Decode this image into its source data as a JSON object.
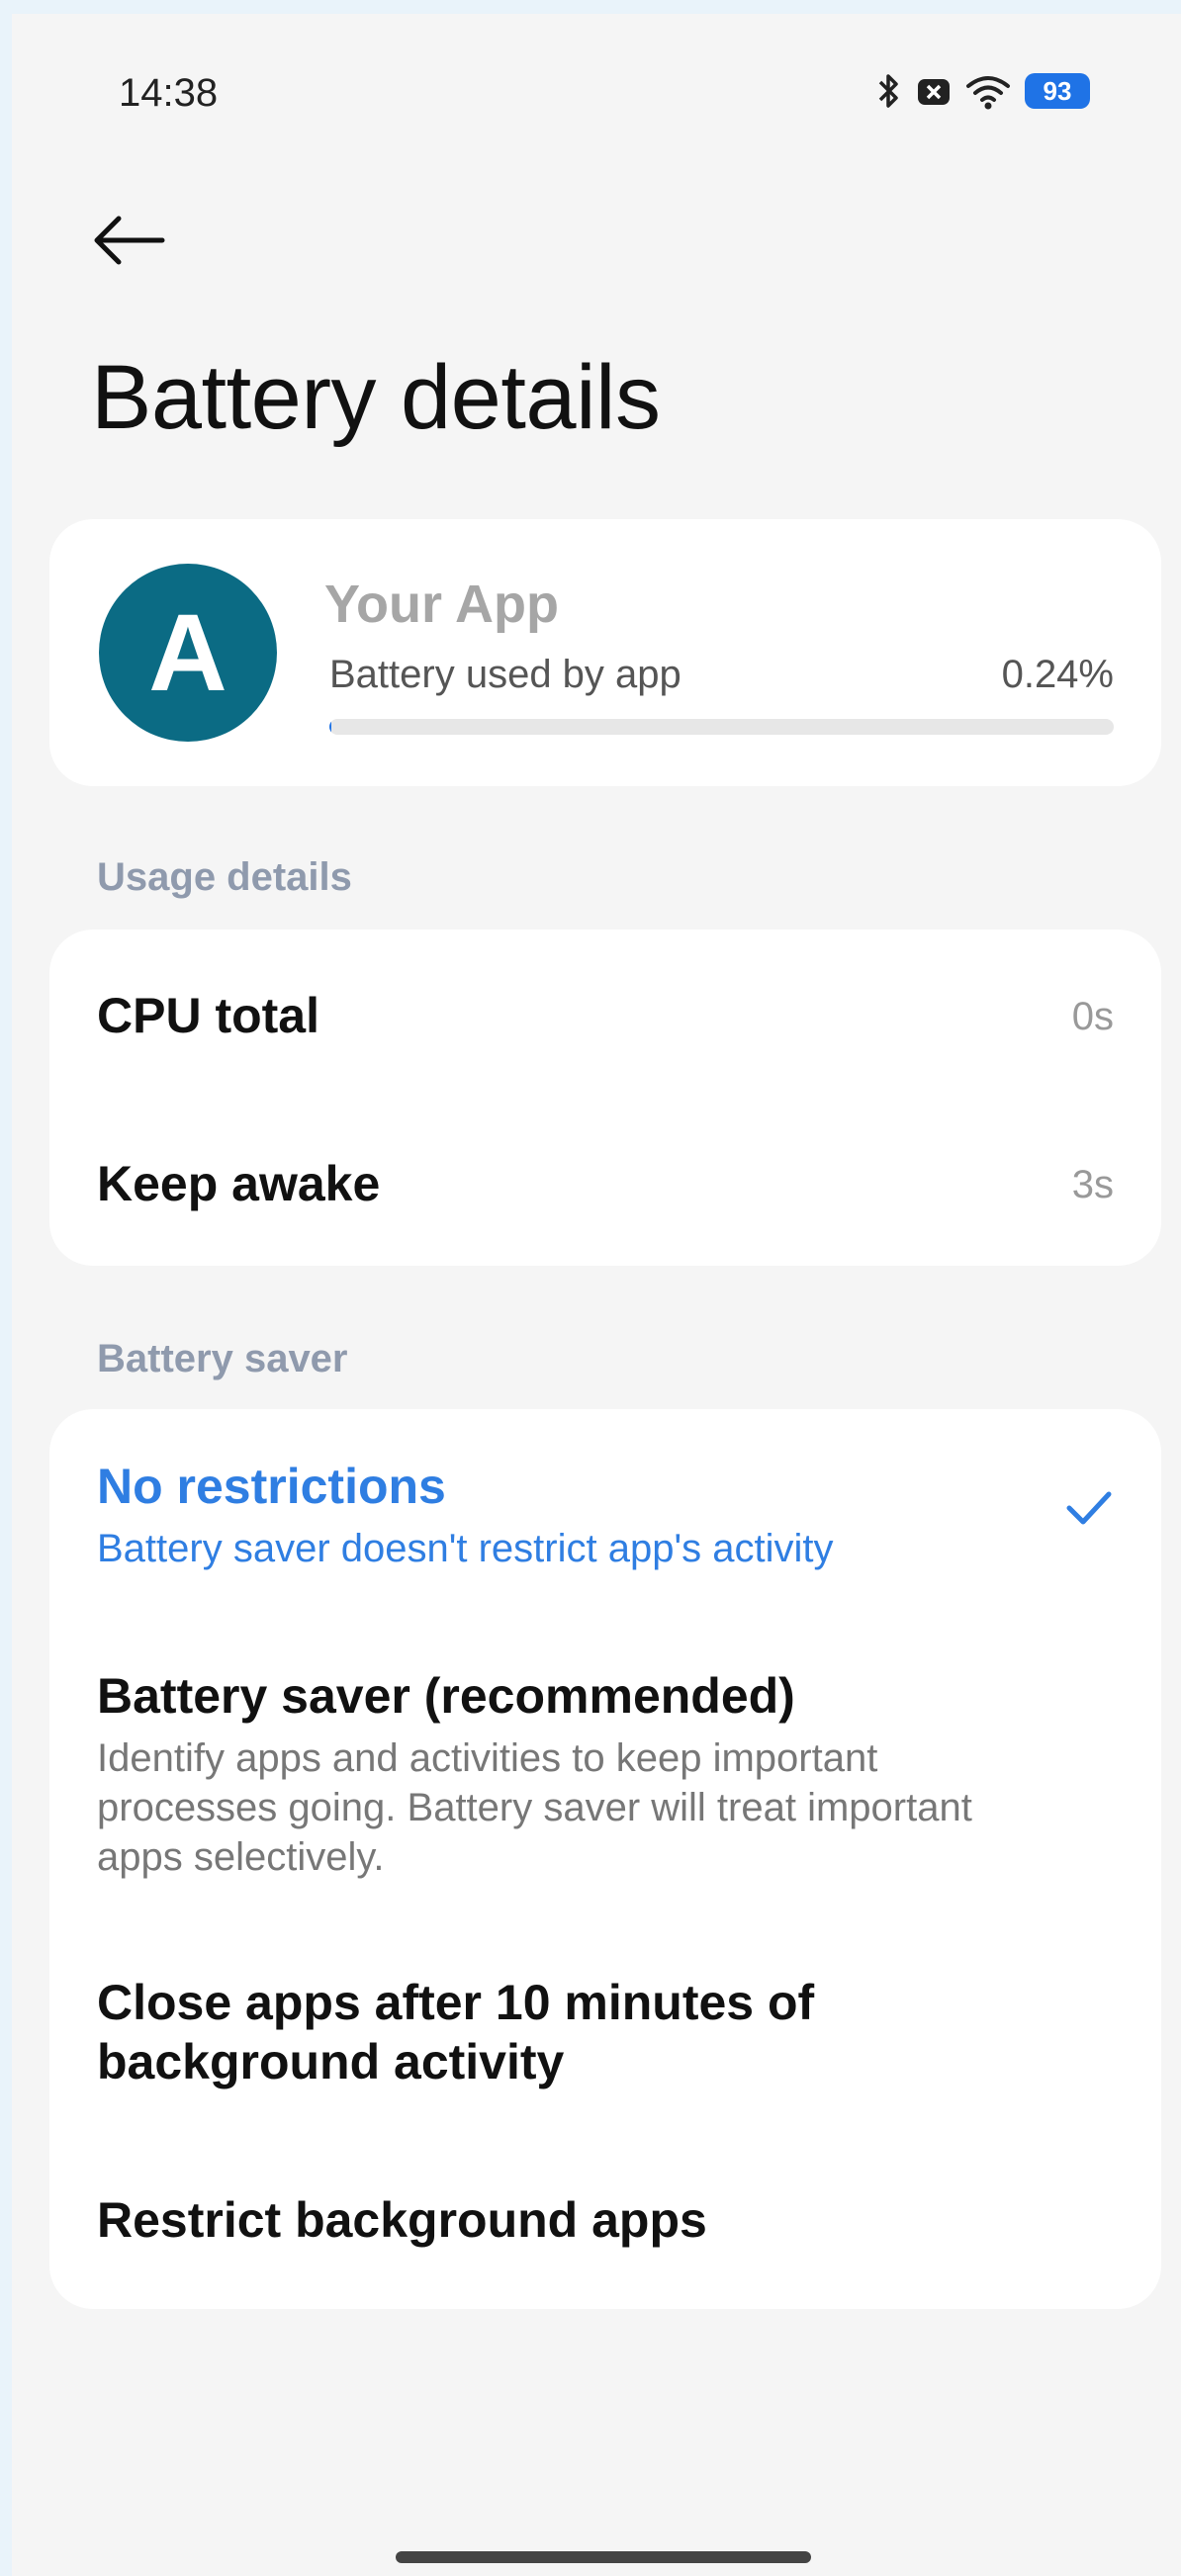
{
  "status_bar": {
    "time": "14:38",
    "battery_level": "93",
    "icons": [
      "bluetooth-icon",
      "notification-x-icon",
      "wifi-icon",
      "battery-icon"
    ]
  },
  "nav": {
    "back_icon": "arrow-left-icon"
  },
  "title": "Battery details",
  "app": {
    "avatar_letter": "A",
    "avatar_color": "#0b6b84",
    "name": "Your App",
    "usage_label": "Battery used by app",
    "usage_value": "0.24%",
    "usage_fraction": 0.0024
  },
  "usage_details": {
    "header": "Usage details",
    "rows": [
      {
        "label": "CPU total",
        "value": "0s"
      },
      {
        "label": "Keep awake",
        "value": "3s"
      }
    ]
  },
  "battery_saver": {
    "header": "Battery saver",
    "options": [
      {
        "title": "No restrictions",
        "description": "Battery saver doesn't restrict app's activity",
        "selected": true
      },
      {
        "title": "Battery saver (recommended)",
        "description": "Identify apps and activities to keep important processes going. Battery saver will treat important apps selectively.",
        "selected": false
      },
      {
        "title": "Close apps after 10 minutes of background activity",
        "description": "",
        "selected": false
      },
      {
        "title": "Restrict background apps",
        "description": "",
        "selected": false
      }
    ]
  },
  "colors": {
    "accent": "#2f7ee2",
    "section_header": "#8f9aad",
    "background": "#f5f5f5"
  }
}
